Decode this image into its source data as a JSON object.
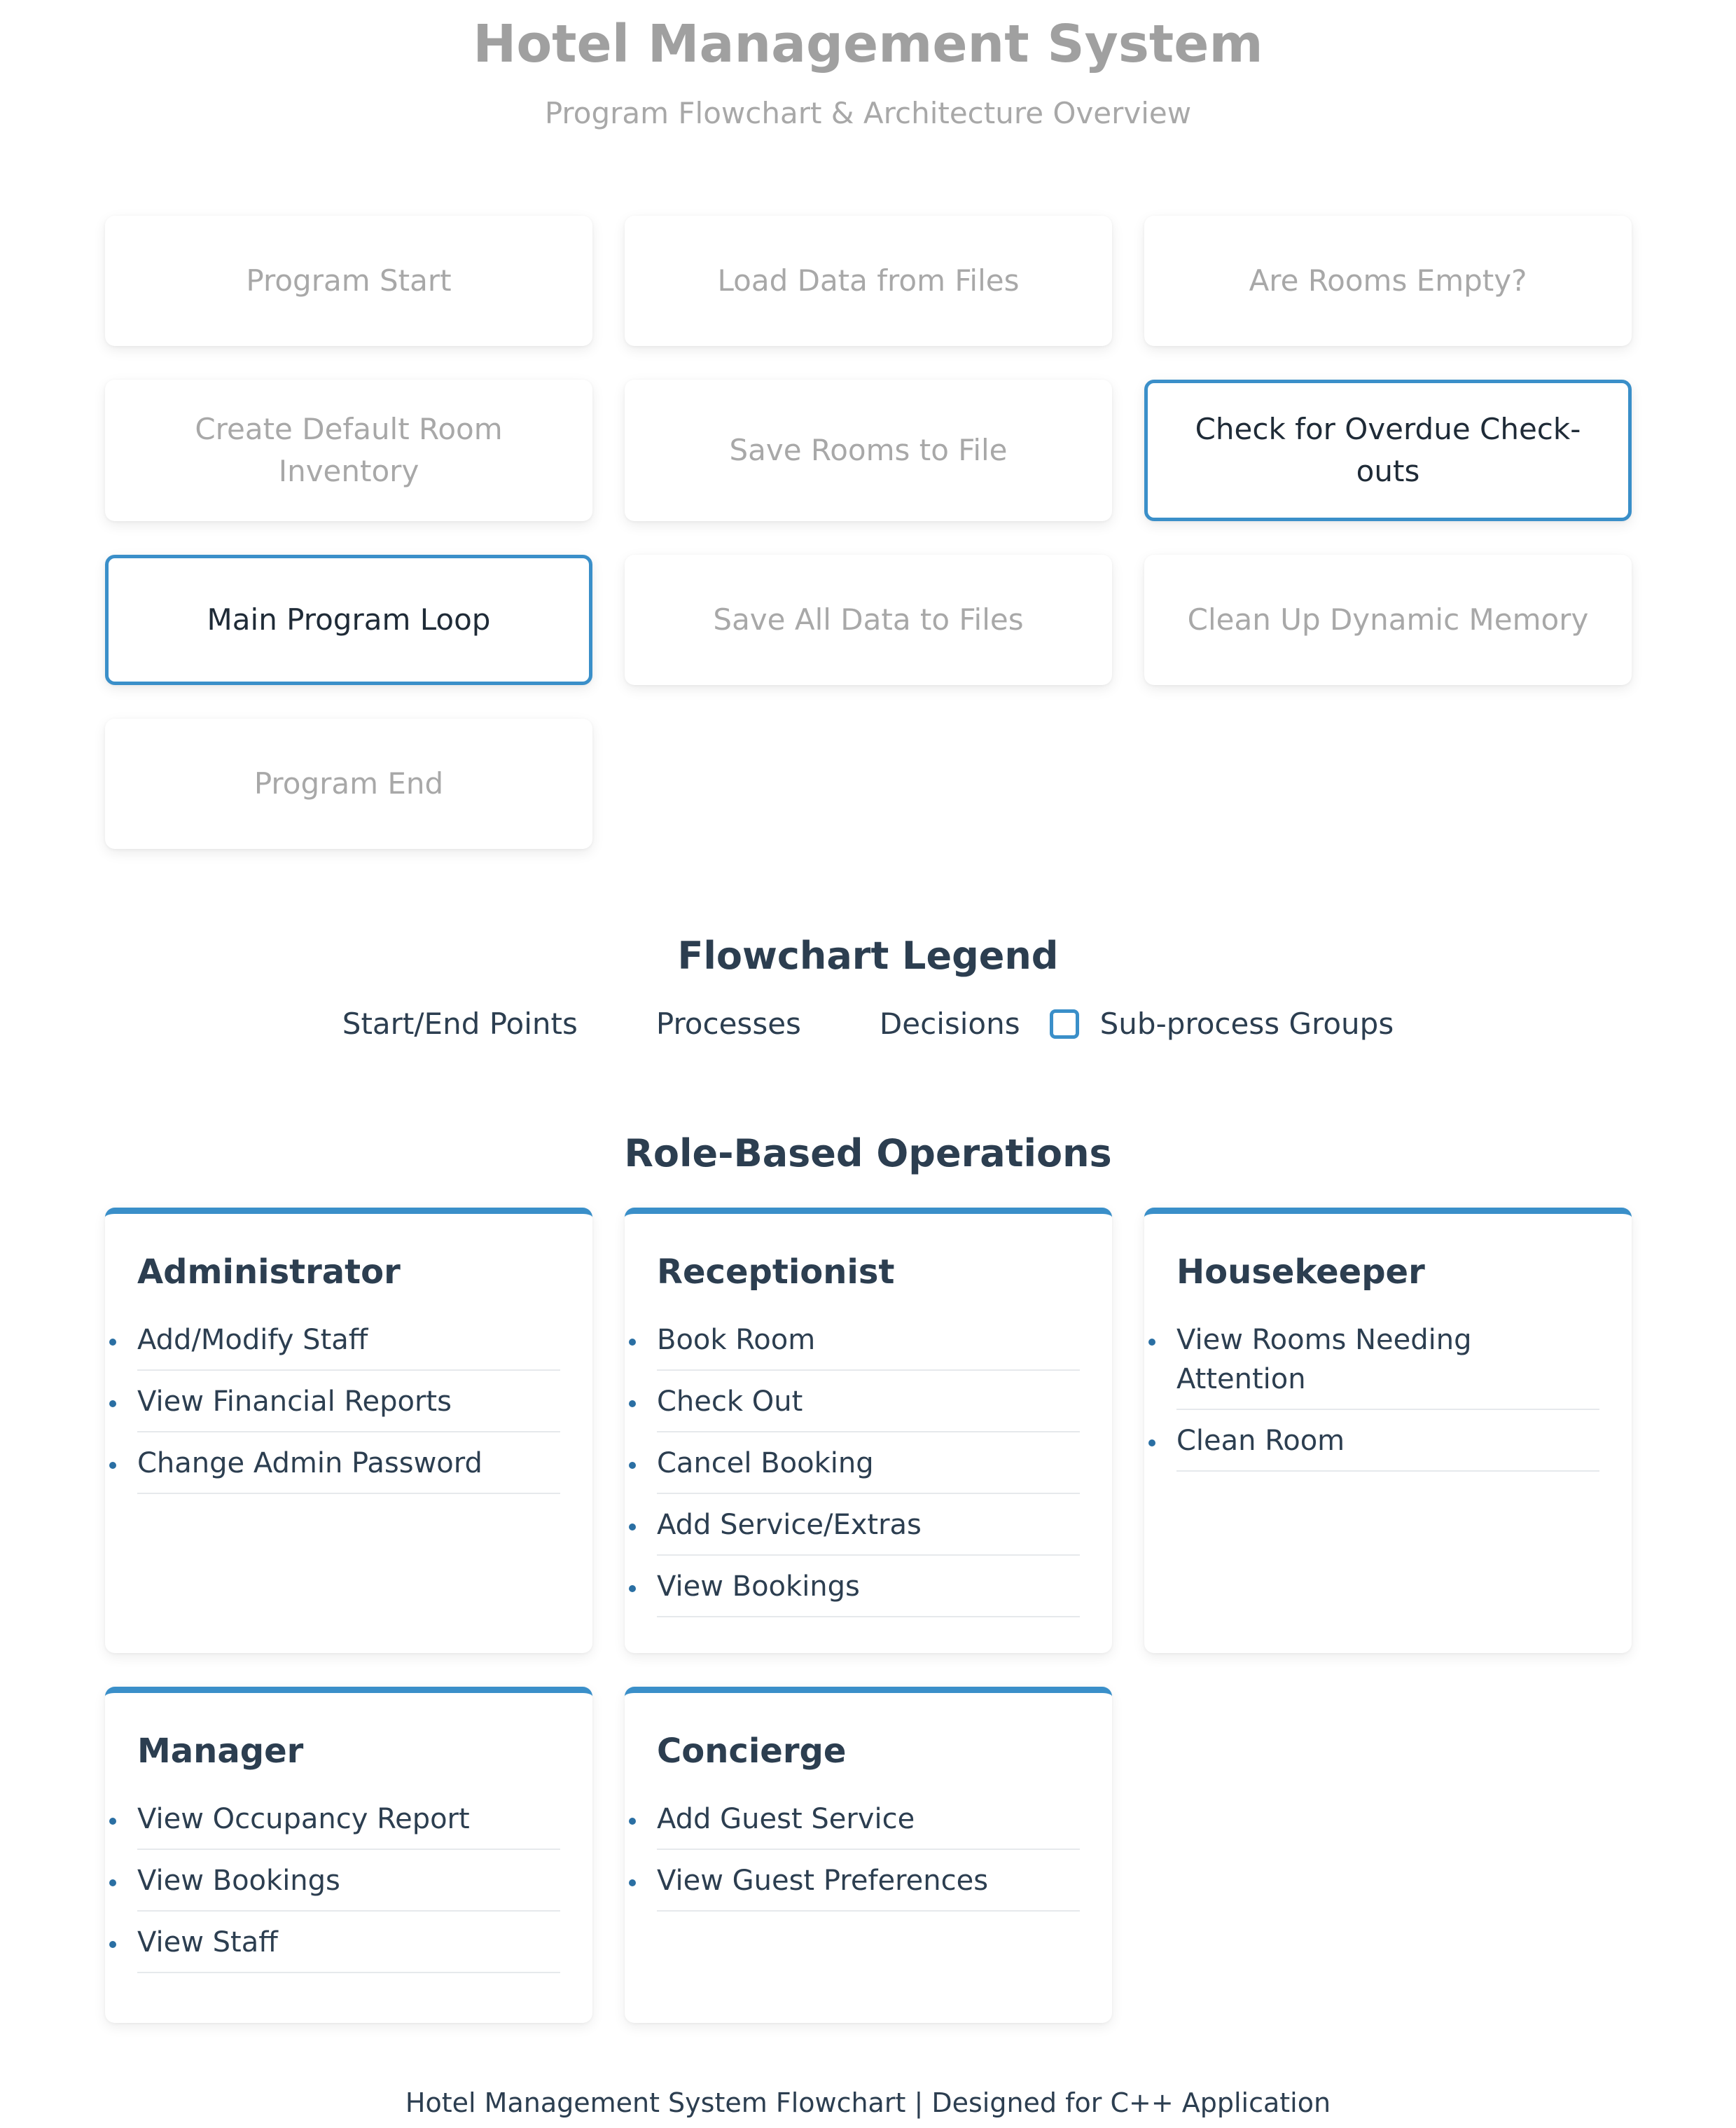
{
  "header": {
    "title": "Hotel Management System",
    "subtitle": "Program Flowchart & Architecture Overview"
  },
  "flow_nodes": [
    {
      "label": "Program Start",
      "highlighted": false
    },
    {
      "label": "Load Data from Files",
      "highlighted": false
    },
    {
      "label": "Are Rooms Empty?",
      "highlighted": false
    },
    {
      "label": "Create Default Room Inventory",
      "highlighted": false
    },
    {
      "label": "Save Rooms to File",
      "highlighted": false
    },
    {
      "label": "Check for Overdue Check-outs",
      "highlighted": true
    },
    {
      "label": "Main Program Loop",
      "highlighted": true
    },
    {
      "label": "Save All Data to Files",
      "highlighted": false
    },
    {
      "label": "Clean Up Dynamic Memory",
      "highlighted": false
    },
    {
      "label": "Program End",
      "highlighted": false
    }
  ],
  "legend": {
    "title": "Flowchart Legend",
    "items": [
      "Start/End Points",
      "Processes",
      "Decisions",
      "Sub-process Groups"
    ]
  },
  "roles": {
    "title": "Role-Based Operations",
    "cards": [
      {
        "name": "Administrator",
        "items": [
          "Add/Modify Staff",
          "View Financial Reports",
          "Change Admin Password"
        ]
      },
      {
        "name": "Receptionist",
        "items": [
          "Book Room",
          "Check Out",
          "Cancel Booking",
          "Add Service/Extras",
          "View Bookings"
        ]
      },
      {
        "name": "Housekeeper",
        "items": [
          "View Rooms Needing Attention",
          "Clean Room"
        ]
      },
      {
        "name": "Manager",
        "items": [
          "View Occupancy Report",
          "View Bookings",
          "View Staff"
        ]
      },
      {
        "name": "Concierge",
        "items": [
          "Add Guest Service",
          "View Guest Preferences"
        ]
      }
    ]
  },
  "colors": {
    "accent": "#3a8fc9",
    "heading": "#2c3e50",
    "muted": "#a8a8a8"
  },
  "footer": {
    "text": "Hotel Management System Flowchart | Designed for C++ Application"
  }
}
